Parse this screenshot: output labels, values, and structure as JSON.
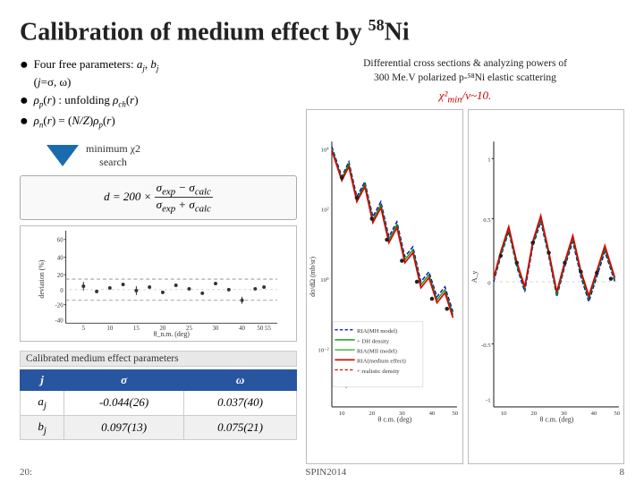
{
  "title": {
    "text": "Calibration of medium effect by ",
    "superscript": "58",
    "element": "Ni"
  },
  "bullets": [
    {
      "id": "b1",
      "text": "Four free parameters: a",
      "subscript_j": "j",
      "text2": ", b",
      "subscript_j2": "j",
      "text3": " (j=σ, ω)"
    },
    {
      "id": "b2",
      "text": "ρ",
      "subscript": "p",
      "text2": "(r) : unfolding ρ",
      "subscript2": "ch",
      "text3": "(r)"
    },
    {
      "id": "b3",
      "text": "ρ",
      "subscript": "n",
      "text2": "(r) = (N/Z)ρ",
      "subscript2": "p",
      "text3": "(r)"
    }
  ],
  "arrow_label": {
    "line1": "minimum χ2",
    "line2": "search"
  },
  "formula": "d = 200 × (σ_exp − σ_calc) / (σ_exp + σ_calc)",
  "chi2_label": "χ²_min/ν~10.",
  "right_desc": {
    "line1": "Differential cross sections & analyzing powers of",
    "line2": "300 Me.V polarized p-⁵⁸Ni elastic scattering"
  },
  "table": {
    "caption": "Calibrated medium effect parameters",
    "headers": [
      "j",
      "σ",
      "ω"
    ],
    "rows": [
      [
        "a_j",
        "-0.044(26)",
        "0.037(40)"
      ],
      [
        "b_j",
        "0.097(13)",
        "0.075(21)"
      ]
    ]
  },
  "legend": {
    "items": [
      {
        "color": "#0000cc",
        "style": "dashed",
        "text": "RIA(MH model)"
      },
      {
        "color": "#009900",
        "style": "solid",
        "text": "+ DH density"
      },
      {
        "color": "#00aa00",
        "style": "solid",
        "text": "RIA(MII model)"
      },
      {
        "color": "#ff0000",
        "style": "solid",
        "text": "RIA(medium effect)"
      },
      {
        "color": "#ff0000",
        "style": "dashed",
        "text": "+ realistic density"
      }
    ]
  },
  "bottom": {
    "left": "20:",
    "conference": "SPIN2014",
    "page": "8"
  },
  "axes": {
    "deviation_ylabel": "deviation (%)",
    "deviation_xlabel": "θ_n.m. (deg)",
    "plot_ylabel": "dσ/dΩ (mb/sr)",
    "plot_xlabel": "θ c.m. (deg)",
    "plot2_ylabel": "A_y",
    "plot2_xlabel": "θ c.m. (deg)"
  }
}
